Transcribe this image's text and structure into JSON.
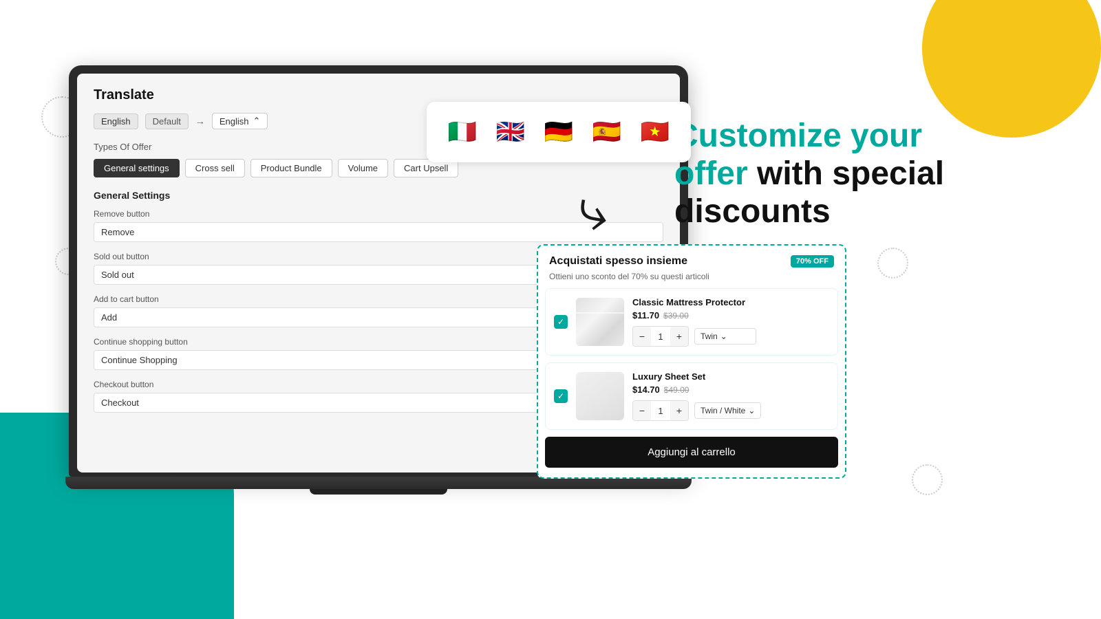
{
  "background": {
    "yellow_circle": "decorative",
    "teal_shape": "decorative"
  },
  "headline": {
    "part1": "Customize your",
    "highlight": "offer",
    "part2": " with special",
    "part3": "discounts"
  },
  "app": {
    "title": "Translate",
    "lang_source": "English",
    "lang_source_type": "Default",
    "lang_target": "English",
    "lang_target_icon": "⌃",
    "types_of_offer_label": "Types Of Offer",
    "tabs": [
      {
        "label": "General settings",
        "active": true
      },
      {
        "label": "Cross sell",
        "active": false
      },
      {
        "label": "Product Bundle",
        "active": false
      },
      {
        "label": "Volume",
        "active": false
      },
      {
        "label": "Cart Upsell",
        "active": false
      }
    ],
    "section_heading": "General Settings",
    "fields": [
      {
        "label": "Remove button",
        "value": "Remove"
      },
      {
        "label": "Sold out button",
        "value": "Sold out"
      },
      {
        "label": "Add to cart button",
        "value": "Add"
      },
      {
        "label": "Continue shopping button",
        "value": "Continue Shopping"
      },
      {
        "label": "Checkout button",
        "value": "Checkout"
      }
    ]
  },
  "flags": [
    "🇮🇹",
    "🇬🇧",
    "🇩🇪",
    "🇪🇸",
    "🇻🇳"
  ],
  "widget": {
    "title": "Acquistati spesso insieme",
    "discount_badge": "70% OFF",
    "subtitle": "Ottieni uno sconto del 70% su questi articoli",
    "products": [
      {
        "name": "Classic Mattress Protector",
        "price_new": "$11.70",
        "price_old": "$39.00",
        "qty": "1",
        "variant": "Twin",
        "checked": true,
        "type": "mattress"
      },
      {
        "name": "Luxury Sheet Set",
        "price_new": "$14.70",
        "price_old": "$49.00",
        "qty": "1",
        "variant": "Twin / White",
        "checked": true,
        "type": "sheet"
      }
    ],
    "add_to_cart_label": "Aggiungi al carrello"
  }
}
